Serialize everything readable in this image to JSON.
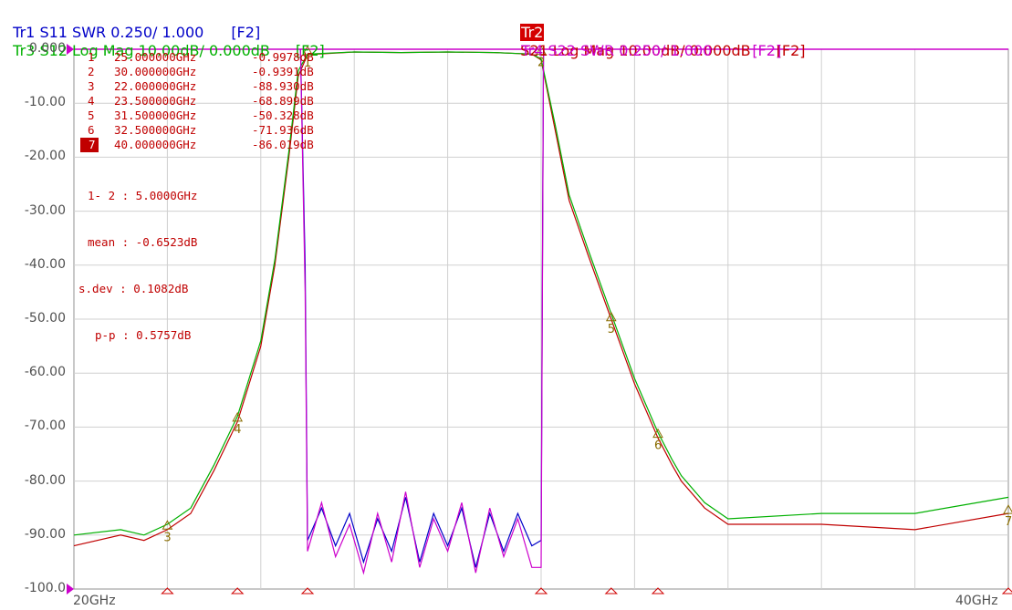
{
  "header": {
    "tr1": "Tr1 S11 SWR 0.250/ 1.000",
    "tr1_key": "[F2]",
    "tr3": "Tr3 S12 Log Mag 10.00dB/ 0.000dB",
    "tr3_key": "[F2]",
    "tr2_badge": "Tr2",
    "tr2": "S21 Log Mag 10.00dB/ 0.000dB",
    "tr2_key": "[F2]",
    "tr4": "Tr4 S22 SWR 0.250/ 1.000",
    "tr4_key": "[F2]"
  },
  "colors": {
    "tr1": "#0000c8",
    "tr2": "#c00000",
    "tr3": "#00b000",
    "tr4": "#cc00cc",
    "grid": "#d0d0d0",
    "reference_line": "#cc00cc",
    "label_text": "#505050"
  },
  "markers": [
    {
      "index": "1",
      "freq": "25.000000GHz",
      "value": "-0.9978dB",
      "active": false
    },
    {
      "index": "2",
      "freq": "30.000000GHz",
      "value": "-0.9391dB",
      "active": false
    },
    {
      "index": "3",
      "freq": "22.000000GHz",
      "value": "-88.930dB",
      "active": false
    },
    {
      "index": "4",
      "freq": "23.500000GHz",
      "value": "-68.899dB",
      "active": false
    },
    {
      "index": "5",
      "freq": "31.500000GHz",
      "value": "-50.328dB",
      "active": false
    },
    {
      "index": "6",
      "freq": "32.500000GHz",
      "value": "-71.936dB",
      "active": false
    },
    {
      "index": "7",
      "freq": "40.000000GHz",
      "value": "-86.019dB",
      "active": true
    }
  ],
  "stats": {
    "span": "1- 2 : 5.0000GHz",
    "mean": "mean : -0.6523dB",
    "sdev": "s.dev : 0.1082dB",
    "pp": "p-p : 0.5757dB"
  },
  "chart_data": {
    "type": "line",
    "xlabel_start": "20GHz",
    "xlabel_stop": "40GHz",
    "xlim": [
      20,
      40
    ],
    "ylim": [
      -100,
      0
    ],
    "yticks": [
      "0.000",
      "-10.00",
      "-20.00",
      "-30.00",
      "-40.00",
      "-50.00",
      "-60.00",
      "-70.00",
      "-80.00",
      "-90.00",
      "-100.0"
    ],
    "grid": true,
    "series": [
      {
        "name": "Tr2 S21",
        "color": "#c00000",
        "x": [
          20,
          21,
          21.5,
          22,
          22.5,
          23,
          23.5,
          24,
          24.3,
          24.6,
          24.8,
          25,
          26,
          27,
          28,
          29,
          29.5,
          29.8,
          30,
          30.3,
          30.6,
          31,
          31.5,
          32,
          32.5,
          32.8,
          33,
          33.5,
          34,
          36,
          38,
          40
        ],
        "y": [
          -92,
          -90,
          -91,
          -89,
          -86,
          -78,
          -69,
          -55,
          -40,
          -20,
          -5,
          -1,
          -0.5,
          -0.6,
          -0.5,
          -0.6,
          -0.8,
          -0.9,
          -2,
          -15,
          -28,
          -38,
          -50,
          -62,
          -72,
          -77,
          -80,
          -85,
          -88,
          -88,
          -89,
          -86
        ]
      },
      {
        "name": "Tr3 S12",
        "color": "#00b000",
        "x": [
          20,
          21,
          21.5,
          22,
          22.5,
          23,
          23.5,
          24,
          24.3,
          24.6,
          24.8,
          25,
          26,
          27,
          28,
          29,
          29.5,
          29.8,
          30,
          30.3,
          30.6,
          31,
          31.5,
          32,
          32.5,
          32.8,
          33,
          33.5,
          34,
          36,
          38,
          40
        ],
        "y": [
          -90,
          -89,
          -90,
          -88,
          -85,
          -77,
          -68,
          -54,
          -39,
          -19,
          -4,
          -0.9,
          -0.5,
          -0.6,
          -0.5,
          -0.6,
          -0.8,
          -0.9,
          -1.8,
          -14,
          -27,
          -37,
          -49,
          -61,
          -71,
          -76,
          -79,
          -84,
          -87,
          -86,
          -86,
          -83
        ]
      },
      {
        "name": "Tr1 S11",
        "color": "#0000c8",
        "x": [
          24.85,
          24.95,
          25.0,
          25.3,
          25.6,
          25.9,
          26.2,
          26.5,
          26.8,
          27.1,
          27.4,
          27.7,
          28.0,
          28.3,
          28.6,
          28.9,
          29.2,
          29.5,
          29.8,
          30.0,
          30.05
        ],
        "y": [
          0,
          -40,
          -91,
          -85,
          -92,
          -86,
          -95,
          -87,
          -93,
          -83,
          -95,
          -86,
          -92,
          -85,
          -96,
          -86,
          -93,
          -86,
          -92,
          -91,
          0
        ]
      },
      {
        "name": "Tr4 S22",
        "color": "#cc00cc",
        "x": [
          24.85,
          24.95,
          25.0,
          25.3,
          25.6,
          25.9,
          26.2,
          26.5,
          26.8,
          27.1,
          27.4,
          27.7,
          28.0,
          28.3,
          28.6,
          28.9,
          29.2,
          29.5,
          29.8,
          30.0,
          30.05
        ],
        "y": [
          0,
          -45,
          -93,
          -84,
          -94,
          -88,
          -97,
          -86,
          -95,
          -82,
          -96,
          -87,
          -93,
          -84,
          -97,
          -85,
          -94,
          -87,
          -96,
          -96,
          0
        ]
      }
    ],
    "marker_points": [
      {
        "label": "1",
        "x": 25.0,
        "y": -1.0
      },
      {
        "label": "2",
        "x": 30.0,
        "y": -0.94
      },
      {
        "label": "3",
        "x": 22.0,
        "y": -88.9
      },
      {
        "label": "4",
        "x": 23.5,
        "y": -68.9
      },
      {
        "label": "5",
        "x": 31.5,
        "y": -50.3
      },
      {
        "label": "6",
        "x": 32.5,
        "y": -71.9
      },
      {
        "label": "7",
        "x": 40.0,
        "y": -86.0
      }
    ]
  }
}
